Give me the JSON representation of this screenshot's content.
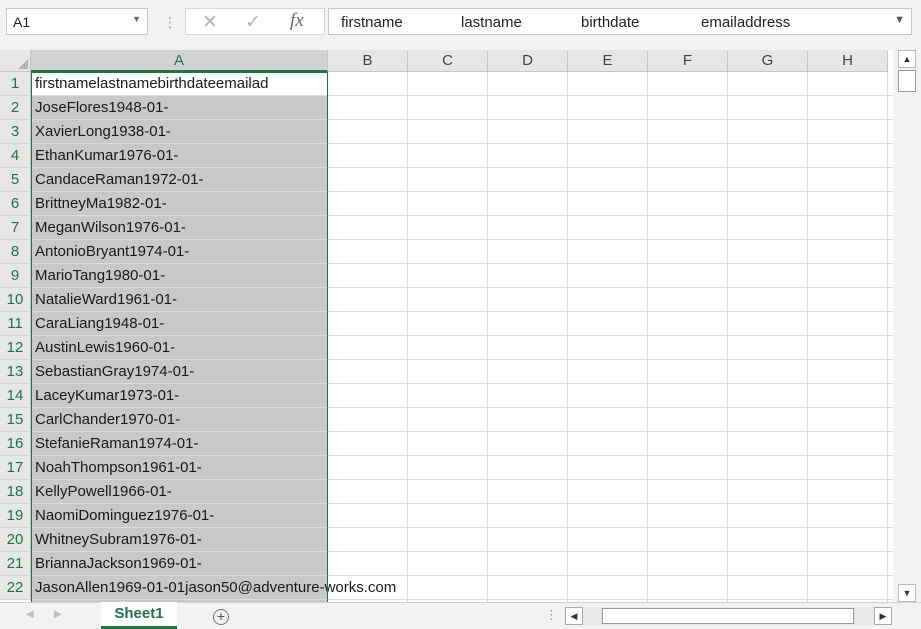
{
  "formula_bar": {
    "name_box": "A1",
    "name_box_icon": "chevron-down-icon",
    "cancel_glyph": "✕",
    "enter_glyph": "✓",
    "fx_label": "fx",
    "content_parts": [
      "firstname",
      "lastname",
      "birthdate",
      "emailaddress"
    ],
    "expand_icon": "chevron-down-icon"
  },
  "grid": {
    "columns": [
      "A",
      "B",
      "C",
      "D",
      "E",
      "F",
      "G",
      "H"
    ],
    "selected_column": "A",
    "rows": [
      {
        "num": "1",
        "a": "firstnamelastnamebirthdateemailad"
      },
      {
        "num": "2",
        "a": "JoseFlores1948-01-"
      },
      {
        "num": "3",
        "a": "XavierLong1938-01-"
      },
      {
        "num": "4",
        "a": "EthanKumar1976-01-"
      },
      {
        "num": "5",
        "a": "CandaceRaman1972-01-"
      },
      {
        "num": "6",
        "a": "BrittneyMa1982-01-"
      },
      {
        "num": "7",
        "a": "MeganWilson1976-01-"
      },
      {
        "num": "8",
        "a": "AntonioBryant1974-01-"
      },
      {
        "num": "9",
        "a": "MarioTang1980-01-"
      },
      {
        "num": "10",
        "a": "NatalieWard1961-01-"
      },
      {
        "num": "11",
        "a": "CaraLiang1948-01-"
      },
      {
        "num": "12",
        "a": "AustinLewis1960-01-"
      },
      {
        "num": "13",
        "a": "SebastianGray1974-01-"
      },
      {
        "num": "14",
        "a": "LaceyKumar1973-01-"
      },
      {
        "num": "15",
        "a": "CarlChander1970-01-"
      },
      {
        "num": "16",
        "a": "StefanieRaman1974-01-"
      },
      {
        "num": "17",
        "a": "NoahThompson1961-01-"
      },
      {
        "num": "18",
        "a": "KellyPowell1966-01-"
      },
      {
        "num": "19",
        "a": "NaomiDominguez1976-01-"
      },
      {
        "num": "20",
        "a": "WhitneySubram1976-01-"
      },
      {
        "num": "21",
        "a": "BriannaJackson1969-01-"
      },
      {
        "num": "22",
        "a": "JasonAllen1969-01-01jason50@adventure-works.com"
      }
    ]
  },
  "sheet_tabs": {
    "active": "Sheet1",
    "add_label": "+"
  },
  "colors": {
    "accent": "#217346",
    "selection_fill": "#c8c8c8",
    "header_fill": "#e6e6e6"
  }
}
